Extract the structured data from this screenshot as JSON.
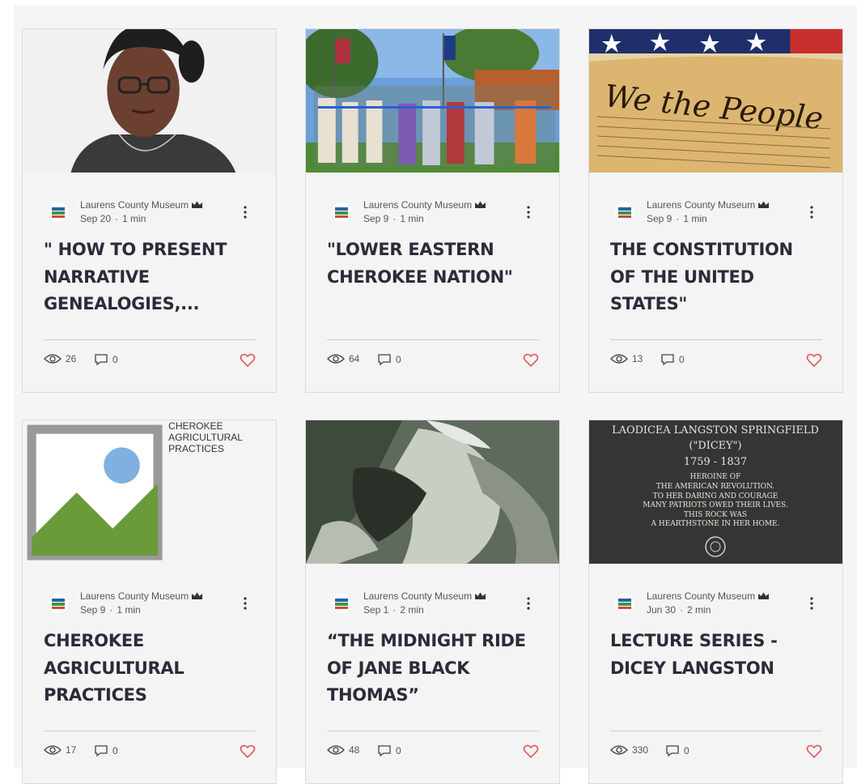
{
  "posts": [
    {
      "author": "Laurens County Museum",
      "date": "Sep 20",
      "read_time": "1 min",
      "title": "\" HOW TO PRESENT NARRATIVE GENEALOGIES,...",
      "views": "26",
      "comments": "0",
      "image": "portrait-photo"
    },
    {
      "author": "Laurens County Museum",
      "date": "Sep 9",
      "read_time": "1 min",
      "title": "\"LOWER EASTERN CHEROKEE NATION\"",
      "views": "64",
      "comments": "0",
      "image": "ribbon-cutting-photo"
    },
    {
      "author": "Laurens County Museum",
      "date": "Sep 9",
      "read_time": "1 min",
      "title": "THE CONSTITUTION OF THE UNITED STATES\"",
      "views": "13",
      "comments": "0",
      "image": "constitution-photo",
      "image_text": "We the People"
    },
    {
      "author": "Laurens County Museum",
      "date": "Sep 9",
      "read_time": "1 min",
      "title": "CHEROKEE AGRICULTURAL PRACTICES",
      "views": "17",
      "comments": "0",
      "image": "broken-image",
      "image_alt": "CHEROKEE AGRICULTURAL PRACTICES"
    },
    {
      "author": "Laurens County Museum",
      "date": "Sep 1",
      "read_time": "2 min",
      "title": "“THE MIDNIGHT RIDE OF JANE BLACK THOMAS”",
      "views": "48",
      "comments": "0",
      "image": "midnight-ride-photo"
    },
    {
      "author": "Laurens County Museum",
      "date": "Jun 30",
      "read_time": "2 min",
      "title": "LECTURE SERIES - DICEY LANGSTON",
      "views": "330",
      "comments": "0",
      "image": "plaque-photo",
      "plaque": {
        "line1": "LAODICEA LANGSTON SPRINGFIELD",
        "line2": "(\"DICEY\")",
        "line3": "1759 - 1837",
        "line4": "HEROINE OF",
        "line5": "THE AMERICAN REVOLUTION.",
        "line6": "TO HER DARING AND COURAGE",
        "line7": "MANY PATRIOTS OWED THEIR LIVES.",
        "line8": "THIS ROCK WAS",
        "line9": "A HEARTHSTONE IN HER HOME."
      }
    }
  ],
  "separator": "·",
  "colors": {
    "title": "#2b2b3a",
    "heart": "#e05a5a",
    "meta": "#555555",
    "card_bg": "#f4f4f4"
  },
  "icons": {
    "more": "more-vertical-icon",
    "crown": "crown-icon",
    "views": "eye-icon",
    "comments": "comment-icon",
    "like": "heart-icon"
  }
}
